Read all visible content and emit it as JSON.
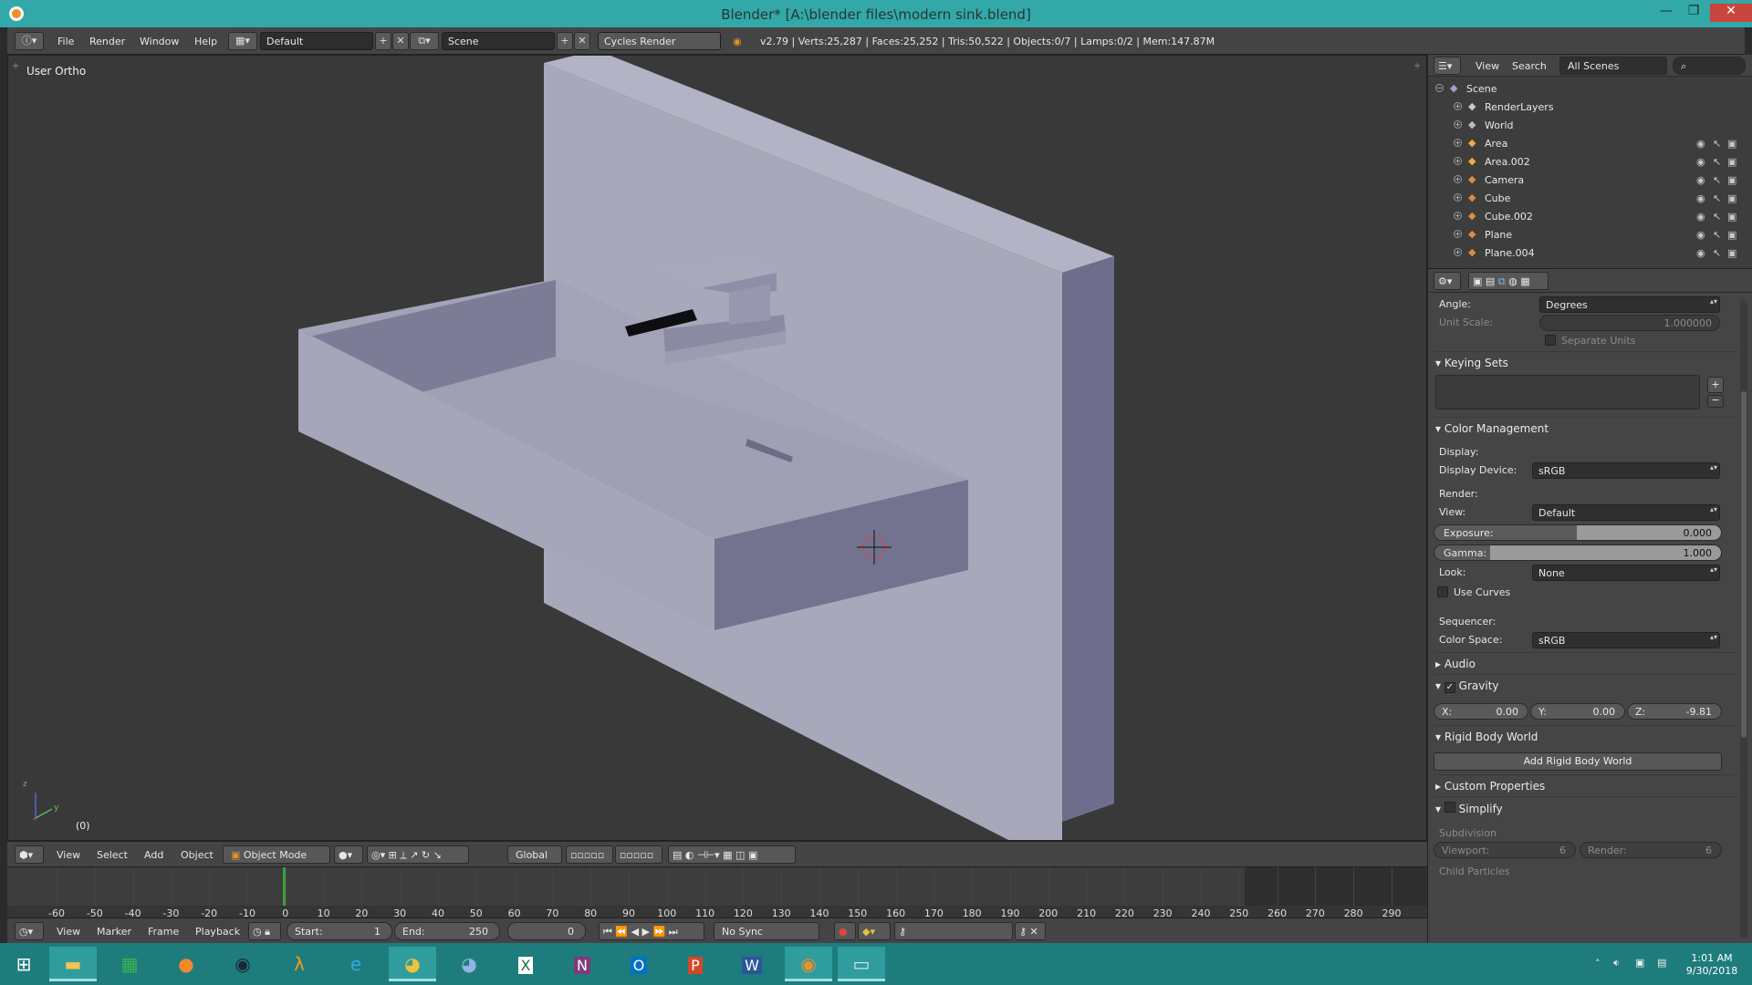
{
  "titlebar": {
    "title": "Blender* [A:\\blender files\\modern sink.blend]",
    "minimize": "—",
    "maximize": "❐",
    "close": "✕"
  },
  "infobar": {
    "menus": [
      "File",
      "Render",
      "Window",
      "Help"
    ],
    "screen_layout": "Default",
    "scene": "Scene",
    "render_engine": "Cycles Render",
    "stats": "v2.79 | Verts:25,287 | Faces:25,252 | Tris:50,522 | Objects:0/7 | Lamps:0/2 | Mem:147.87M"
  },
  "viewport": {
    "view_label": "User Ortho",
    "frame_label": "(0)",
    "axis_labels": [
      "z",
      "y"
    ]
  },
  "view_header": {
    "menus": [
      "View",
      "Select",
      "Add",
      "Object"
    ],
    "mode": "Object Mode",
    "orientation": "Global"
  },
  "timeline": {
    "ticks": [
      "-60",
      "-50",
      "-40",
      "-30",
      "-20",
      "-10",
      "0",
      "10",
      "20",
      "30",
      "40",
      "50",
      "60",
      "70",
      "80",
      "90",
      "100",
      "110",
      "120",
      "130",
      "140",
      "150",
      "160",
      "170",
      "180",
      "190",
      "200",
      "210",
      "220",
      "230",
      "240",
      "250",
      "260",
      "270",
      "280",
      "290"
    ],
    "current_frame_tick": "0",
    "end_frame_tick": "250"
  },
  "timeline_header": {
    "menus": [
      "View",
      "Marker",
      "Frame",
      "Playback"
    ],
    "start_label": "Start:",
    "start_value": "1",
    "end_label": "End:",
    "end_value": "250",
    "current_value": "0",
    "sync": "No Sync"
  },
  "outliner": {
    "menus": [
      "View",
      "Search"
    ],
    "display_mode": "All Scenes",
    "items": [
      {
        "label": "Scene",
        "depth": 0,
        "icon": "scene-icon",
        "color": "#9aa4c8"
      },
      {
        "label": "RenderLayers",
        "depth": 1,
        "icon": "render-layers-icon",
        "color": "#c9c9c9"
      },
      {
        "label": "World",
        "depth": 1,
        "icon": "world-icon",
        "color": "#b8b8c8"
      },
      {
        "label": "Area",
        "depth": 1,
        "icon": "lamp-icon",
        "color": "#e8b040"
      },
      {
        "label": "Area.002",
        "depth": 1,
        "icon": "lamp-icon",
        "color": "#e8b040"
      },
      {
        "label": "Camera",
        "depth": 1,
        "icon": "camera-icon",
        "color": "#e08a40"
      },
      {
        "label": "Cube",
        "depth": 1,
        "icon": "mesh-icon",
        "color": "#e08a40"
      },
      {
        "label": "Cube.002",
        "depth": 1,
        "icon": "mesh-icon",
        "color": "#e08a40"
      },
      {
        "label": "Plane",
        "depth": 1,
        "icon": "mesh-icon",
        "color": "#e08a40"
      },
      {
        "label": "Plane.004",
        "depth": 1,
        "icon": "mesh-icon",
        "color": "#e08a40"
      }
    ]
  },
  "properties": {
    "angle_label": "Angle:",
    "angle_value": "Degrees",
    "unit_scale_label": "Unit Scale:",
    "unit_scale_value": "1.000000",
    "separate_units": "Separate Units",
    "keying_sets": "Keying Sets",
    "color_management": "Color Management",
    "display_label": "Display:",
    "display_device_label": "Display Device:",
    "display_device_value": "sRGB",
    "render_label": "Render:",
    "view_label": "View:",
    "view_value": "Default",
    "exposure_label": "Exposure:",
    "exposure_value": "0.000",
    "exposure_fill": 0.5,
    "gamma_label": "Gamma:",
    "gamma_value": "1.000",
    "gamma_fill": 0.2,
    "look_label": "Look:",
    "look_value": "None",
    "use_curves": "Use Curves",
    "sequencer_label": "Sequencer:",
    "color_space_label": "Color Space:",
    "color_space_value": "sRGB",
    "audio": "Audio",
    "gravity": "Gravity",
    "gravity_x_label": "X:",
    "gravity_x": "0.00",
    "gravity_y_label": "Y:",
    "gravity_y": "0.00",
    "gravity_z_label": "Z:",
    "gravity_z": "-9.81",
    "rigid_body_world": "Rigid Body World",
    "add_rigid_body_world": "Add Rigid Body World",
    "custom_properties": "Custom Properties",
    "simplify": "Simplify",
    "subdivision": "Subdivision",
    "viewport_label": "Viewport:",
    "viewport_value": "6",
    "render_sub_label": "Render:",
    "render_sub_value": "6",
    "child_particles": "Child Particles"
  },
  "taskbar": {
    "apps": [
      "start-button",
      "file-explorer",
      "store",
      "firefox",
      "steam",
      "half-life",
      "internet-explorer",
      "chrome",
      "chrome-canary",
      "excel",
      "onenote",
      "outlook",
      "powerpoint",
      "word",
      "blender",
      "photos"
    ],
    "time": "1:01 AM",
    "date": "9/30/2018"
  },
  "colors": {
    "titlebar": "#33a8a8",
    "taskbar": "#1e7c7d",
    "viewport_bg": "#393939",
    "model_light": "#a9a9bc",
    "model_shade": "#7b7b92"
  }
}
